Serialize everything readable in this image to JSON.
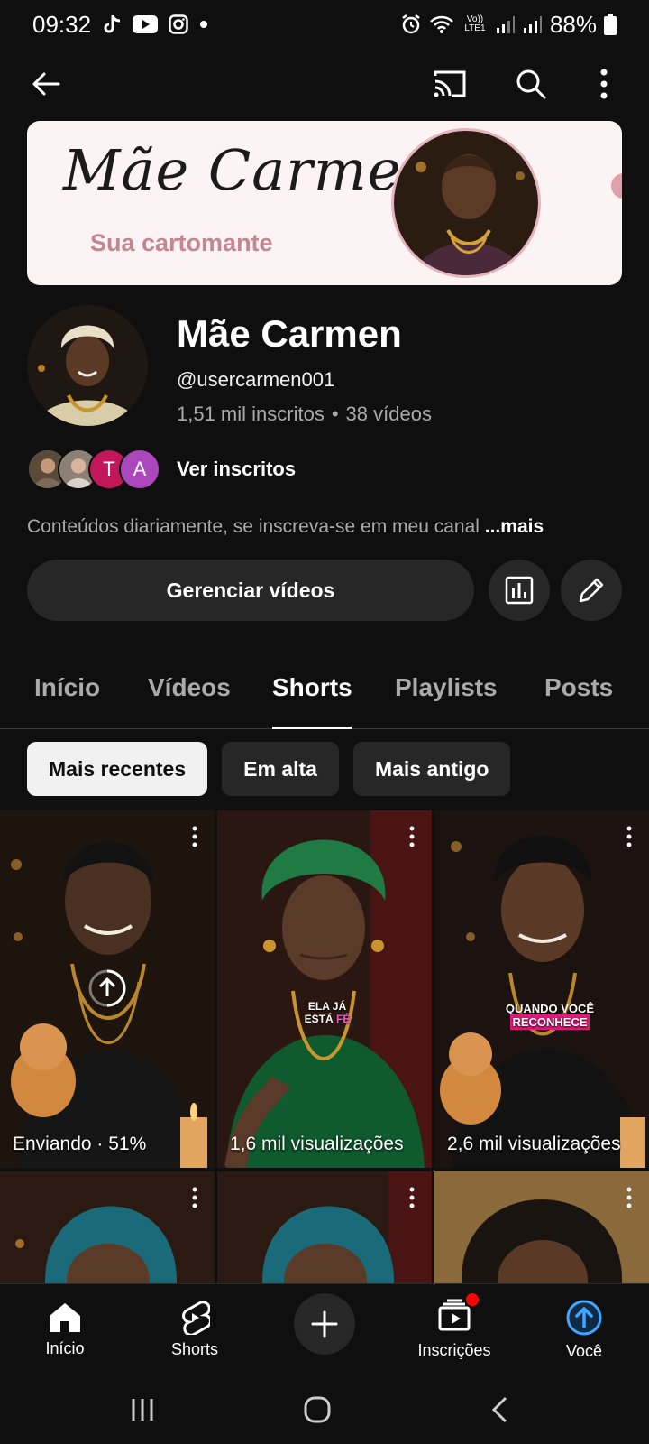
{
  "status_bar": {
    "time": "09:32",
    "network": "Vo)) LTE1",
    "battery": "88%"
  },
  "app_bar": {
    "icons": [
      "back-arrow-icon",
      "cast-icon",
      "search-icon",
      "more-vert-icon"
    ]
  },
  "banner": {
    "script_title": "Mãe Carmen",
    "subtitle": "Sua cartomante"
  },
  "channel": {
    "name": "Mãe Carmen",
    "handle": "@usercarmen001",
    "subscribers": "1,51 mil inscritos",
    "separator": "•",
    "videos": "38 vídeos",
    "subscriber_avatars": [
      {
        "letter": "",
        "color": "#6b6b6b"
      },
      {
        "letter": "",
        "color": "#8a8a8a"
      },
      {
        "letter": "T",
        "color": "#c2185b"
      },
      {
        "letter": "A",
        "color": "#ab47bc"
      }
    ],
    "see_subscribers": "Ver inscritos",
    "description": "Conteúdos diariamente, se inscreva-se em meu canal",
    "more": "...mais",
    "manage_button": "Gerenciar vídeos"
  },
  "tabs": [
    {
      "label": "Início",
      "active": false
    },
    {
      "label": "Vídeos",
      "active": false
    },
    {
      "label": "Shorts",
      "active": true
    },
    {
      "label": "Playlists",
      "active": false
    },
    {
      "label": "Posts",
      "active": false
    }
  ],
  "chips": [
    {
      "label": "Mais recentes",
      "selected": true
    },
    {
      "label": "Em alta",
      "selected": false
    },
    {
      "label": "Mais antigo",
      "selected": false
    }
  ],
  "shorts": [
    {
      "caption": "Enviando · 51%",
      "overlay": "",
      "highlight": ""
    },
    {
      "caption": "1,6 mil visualizações",
      "overlay": "ELA JÁ ESTÁ",
      "highlight": "FÉ"
    },
    {
      "caption": "2,6 mil visualizações",
      "overlay": "QUANDO VOCÊ",
      "highlight": "RECONHECE"
    },
    {
      "caption": "",
      "overlay": "",
      "highlight": ""
    },
    {
      "caption": "",
      "overlay": "",
      "highlight": ""
    },
    {
      "caption": "",
      "overlay": "",
      "highlight": ""
    }
  ],
  "bottom_nav": {
    "home": "Início",
    "shorts": "Shorts",
    "subscriptions": "Inscrições",
    "you": "Você"
  },
  "colors": {
    "background": "#0f0f0f",
    "surface": "#272727",
    "accent_blue": "#3ea6ff",
    "notification_red": "#ff0000",
    "banner_bg": "#fcf3f5",
    "banner_subtitle": "#c48690"
  }
}
